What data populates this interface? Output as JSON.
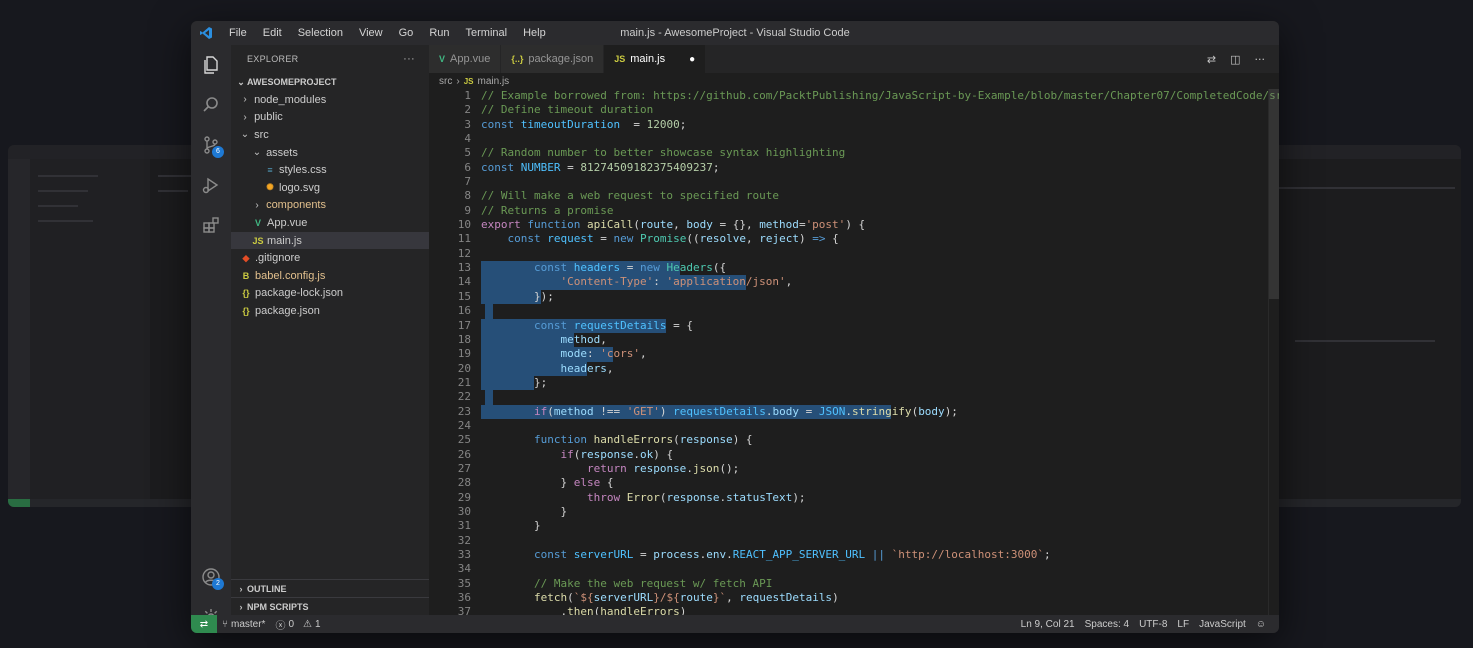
{
  "window_title": "main.js - AwesomeProject - Visual Studio Code",
  "menu": [
    "File",
    "Edit",
    "Selection",
    "View",
    "Go",
    "Run",
    "Terminal",
    "Help"
  ],
  "activity_bar": {
    "icons": [
      "files-icon",
      "search-icon",
      "source-control-icon",
      "run-debug-icon",
      "extensions-icon"
    ],
    "scm_badge": "6",
    "account_badge": "2"
  },
  "explorer": {
    "title": "EXPLORER",
    "more": "···",
    "project": "AWESOMEPROJECT",
    "items": [
      {
        "label": "node_modules",
        "kind": "folder",
        "depth": 0,
        "open": false
      },
      {
        "label": "public",
        "kind": "folder",
        "depth": 0,
        "open": false
      },
      {
        "label": "src",
        "kind": "folder",
        "depth": 0,
        "open": true
      },
      {
        "label": "assets",
        "kind": "folder",
        "depth": 1,
        "open": true
      },
      {
        "label": "styles.css",
        "kind": "css",
        "depth": 2
      },
      {
        "label": "logo.svg",
        "kind": "svg",
        "depth": 2
      },
      {
        "label": "components",
        "kind": "folder",
        "depth": 1,
        "open": false
      },
      {
        "label": "App.vue",
        "kind": "vue",
        "depth": 1
      },
      {
        "label": "main.js",
        "kind": "js",
        "depth": 1,
        "active": true
      },
      {
        "label": ".gitignore",
        "kind": "git",
        "depth": 0
      },
      {
        "label": "babel.config.js",
        "kind": "babel",
        "depth": 0
      },
      {
        "label": "package-lock.json",
        "kind": "json",
        "depth": 0
      },
      {
        "label": "package.json",
        "kind": "json",
        "depth": 0
      }
    ],
    "outline": "OUTLINE",
    "npm_scripts": "NPM SCRIPTS"
  },
  "tabs": [
    {
      "label": "App.vue",
      "icon": "V",
      "active": false,
      "modified": false
    },
    {
      "label": "package.json",
      "icon": "{..}",
      "active": false,
      "modified": false
    },
    {
      "label": "main.js",
      "icon": "JS",
      "active": true,
      "modified": true
    }
  ],
  "breadcrumb": [
    "src",
    "main.js"
  ],
  "code": {
    "start_line": 1,
    "lines": [
      [
        [
          "c-com",
          "// Example borrowed from: https://github.com/PacktPublishing/JavaScript-by-Example/blob/master/Chapter07/CompletedCode/src/se"
        ]
      ],
      [
        [
          "c-com",
          "// Define timeout duration"
        ]
      ],
      [
        [
          "c-kw",
          "const "
        ],
        [
          "c-const",
          "timeoutDuration"
        ],
        [
          "",
          "  = "
        ],
        [
          "c-num",
          "12000"
        ],
        [
          "",
          ";"
        ]
      ],
      [],
      [
        [
          "c-com",
          "// Random number to better showcase syntax highlighting"
        ]
      ],
      [
        [
          "c-kw",
          "const "
        ],
        [
          "c-const",
          "NUMBER"
        ],
        [
          "",
          " = "
        ],
        [
          "c-num",
          "8127450918237540923"
        ],
        [
          "c-num",
          "7"
        ],
        [
          "",
          ";"
        ]
      ],
      [],
      [
        [
          "c-com",
          "// Will make a web request to specified route"
        ]
      ],
      [
        [
          "c-com",
          "// Returns a promise"
        ]
      ],
      [
        [
          "c-ctl",
          "export "
        ],
        [
          "c-kw",
          "function "
        ],
        [
          "c-fn",
          "apiCall"
        ],
        [
          "",
          "("
        ],
        [
          "c-var",
          "route"
        ],
        [
          "",
          ", "
        ],
        [
          "c-var",
          "body"
        ],
        [
          "",
          " = {}, "
        ],
        [
          "c-var",
          "method"
        ],
        [
          "",
          "="
        ],
        [
          "c-str",
          "'post'"
        ],
        [
          "",
          ") {"
        ]
      ],
      [
        [
          "",
          "    "
        ],
        [
          "c-kw",
          "const "
        ],
        [
          "c-const",
          "request"
        ],
        [
          "",
          " = "
        ],
        [
          "c-kw",
          "new "
        ],
        [
          "c-cls",
          "Promise"
        ],
        [
          "",
          "(("
        ],
        [
          "c-var",
          "resolve"
        ],
        [
          "",
          ", "
        ],
        [
          "c-var",
          "reject"
        ],
        [
          "",
          ") "
        ],
        [
          "c-kw",
          "=>"
        ],
        [
          "",
          " {"
        ]
      ],
      [],
      [
        [
          "",
          "        "
        ],
        [
          "c-kw",
          "const "
        ],
        [
          "c-const",
          "headers"
        ],
        [
          "",
          " = "
        ],
        [
          "c-kw",
          "new "
        ],
        [
          "c-cls",
          "Headers"
        ],
        [
          "",
          "({"
        ]
      ],
      [
        [
          "",
          "            "
        ],
        [
          "c-str",
          "'Content-Type'"
        ],
        [
          "",
          ": "
        ],
        [
          "c-str",
          "'application/json'"
        ],
        [
          "",
          ","
        ]
      ],
      [
        [
          "",
          "        });"
        ]
      ],
      [],
      [
        [
          "",
          "        "
        ],
        [
          "c-kw",
          "const "
        ],
        [
          "c-const",
          "requestDetails"
        ],
        [
          "",
          " = {"
        ]
      ],
      [
        [
          "",
          "            "
        ],
        [
          "c-var",
          "method"
        ],
        [
          "",
          ","
        ]
      ],
      [
        [
          "",
          "            "
        ],
        [
          "c-var",
          "mode"
        ],
        [
          "",
          ": "
        ],
        [
          "c-str",
          "'cors'"
        ],
        [
          "",
          ","
        ]
      ],
      [
        [
          "",
          "            "
        ],
        [
          "c-var",
          "headers"
        ],
        [
          "",
          ","
        ]
      ],
      [
        [
          "",
          "        };"
        ]
      ],
      [],
      [
        [
          "",
          "        "
        ],
        [
          "c-ctl",
          "if"
        ],
        [
          "",
          "("
        ],
        [
          "c-var",
          "method"
        ],
        [
          "",
          " !== "
        ],
        [
          "c-str",
          "'GET'"
        ],
        [
          "",
          ") "
        ],
        [
          "c-const",
          "requestDetails"
        ],
        [
          "",
          "."
        ],
        [
          "c-var",
          "body"
        ],
        [
          "",
          " = "
        ],
        [
          "c-const",
          "JSON"
        ],
        [
          "",
          "."
        ],
        [
          "c-fn",
          "stringify"
        ],
        [
          "",
          "("
        ],
        [
          "c-var",
          "body"
        ],
        [
          "",
          ");"
        ]
      ],
      [],
      [
        [
          "",
          "        "
        ],
        [
          "c-kw",
          "function "
        ],
        [
          "c-fn",
          "handleErrors"
        ],
        [
          "",
          "("
        ],
        [
          "c-var",
          "response"
        ],
        [
          "",
          ") {"
        ]
      ],
      [
        [
          "",
          "            "
        ],
        [
          "c-ctl",
          "if"
        ],
        [
          "",
          "("
        ],
        [
          "c-var",
          "response"
        ],
        [
          "",
          "."
        ],
        [
          "c-var",
          "ok"
        ],
        [
          "",
          ") {"
        ]
      ],
      [
        [
          "",
          "                "
        ],
        [
          "c-ctl",
          "return "
        ],
        [
          "c-var",
          "response"
        ],
        [
          "",
          "."
        ],
        [
          "c-fn",
          "json"
        ],
        [
          "",
          "();"
        ]
      ],
      [
        [
          "",
          "            } "
        ],
        [
          "c-ctl",
          "else"
        ],
        [
          "",
          " {"
        ]
      ],
      [
        [
          "",
          "                "
        ],
        [
          "c-ctl",
          "throw "
        ],
        [
          "c-fn",
          "Error"
        ],
        [
          "",
          "("
        ],
        [
          "c-var",
          "response"
        ],
        [
          "",
          "."
        ],
        [
          "c-var",
          "statusText"
        ],
        [
          "",
          ");"
        ]
      ],
      [
        [
          "",
          "            }"
        ]
      ],
      [
        [
          "",
          "        }"
        ]
      ],
      [],
      [
        [
          "",
          "        "
        ],
        [
          "c-kw",
          "const "
        ],
        [
          "c-const",
          "serverURL"
        ],
        [
          "",
          " = "
        ],
        [
          "c-var",
          "process"
        ],
        [
          "",
          "."
        ],
        [
          "c-var",
          "env"
        ],
        [
          "",
          "."
        ],
        [
          "c-const",
          "REACT_APP_SERVER_URL"
        ],
        [
          "",
          " "
        ],
        [
          "c-kw",
          "||"
        ],
        [
          "",
          " "
        ],
        [
          "c-str",
          "`http://localhost:3000`"
        ],
        [
          "",
          ";"
        ]
      ],
      [],
      [
        [
          "",
          "        "
        ],
        [
          "c-com",
          "// Make the web request w/ fetch API"
        ]
      ],
      [
        [
          "",
          "        "
        ],
        [
          "c-fn",
          "fetch"
        ],
        [
          "",
          "("
        ],
        [
          "c-str",
          "`${"
        ],
        [
          "c-var",
          "serverURL"
        ],
        [
          "c-str",
          "}/${"
        ],
        [
          "c-var",
          "route"
        ],
        [
          "c-str",
          "}`"
        ],
        [
          "",
          ", "
        ],
        [
          "c-var",
          "requestDetails"
        ],
        [
          "",
          ")"
        ]
      ],
      [
        [
          "",
          "            ."
        ],
        [
          "c-fn",
          "then"
        ],
        [
          "",
          "("
        ],
        [
          "c-fn",
          "handleErrors"
        ],
        [
          "",
          ")"
        ]
      ]
    ]
  },
  "status": {
    "branch": "master*",
    "errors": "0",
    "warnings": "1",
    "position": "Ln 9, Col 21",
    "spaces": "Spaces: 4",
    "encoding": "UTF-8",
    "eol": "LF",
    "language": "JavaScript"
  },
  "colors": {
    "accent_blue": "#1e79d4",
    "remote_green": "#2f8a4f",
    "selection": "#264f78"
  }
}
